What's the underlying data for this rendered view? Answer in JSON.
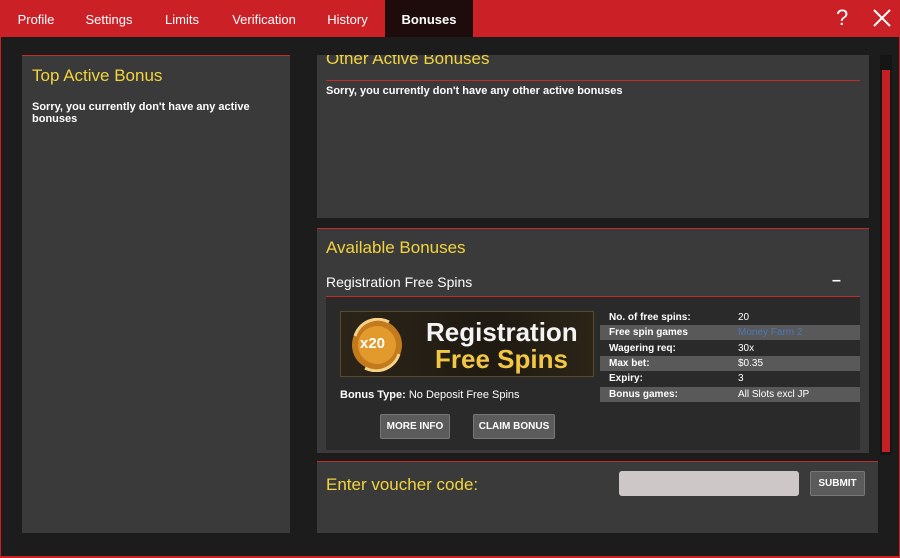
{
  "tabs": [
    {
      "label": "Profile"
    },
    {
      "label": "Settings"
    },
    {
      "label": "Limits"
    },
    {
      "label": "Verification"
    },
    {
      "label": "History"
    },
    {
      "label": "Bonuses",
      "active": true
    }
  ],
  "header": {
    "help_label": "?"
  },
  "top_active": {
    "title": "Top Active Bonus",
    "message": "Sorry, you currently don't have any active bonuses"
  },
  "other_active": {
    "title": "Other Active Bonuses",
    "message": "Sorry, you currently don't have any other active bonuses"
  },
  "available": {
    "title": "Available Bonuses",
    "bonus_name": "Registration Free Spins",
    "collapse_label": "–",
    "banner": {
      "badge": "x20",
      "line1": "Registration",
      "line2": "Free Spins"
    },
    "bonus_type_label": "Bonus Type:",
    "bonus_type_value": "No Deposit Free Spins",
    "details": [
      {
        "label": "No. of free spins:",
        "value": "20"
      },
      {
        "label": "Free spin games",
        "value": "Money Farm 2",
        "link": true
      },
      {
        "label": "Wagering req:",
        "value": "30x"
      },
      {
        "label": "Max bet:",
        "value": "$0.35"
      },
      {
        "label": "Expiry:",
        "value": "3"
      },
      {
        "label": "Bonus games:",
        "value": "All Slots excl JP"
      }
    ],
    "more_info_label": "MORE INFO",
    "claim_label": "CLAIM BONUS"
  },
  "voucher": {
    "title": "Enter voucher code:",
    "input_value": "",
    "submit_label": "SUBMIT"
  },
  "colors": {
    "brand_red": "#cc2027",
    "heading_yellow": "#f2d43f",
    "link_blue": "#4a78b5"
  }
}
